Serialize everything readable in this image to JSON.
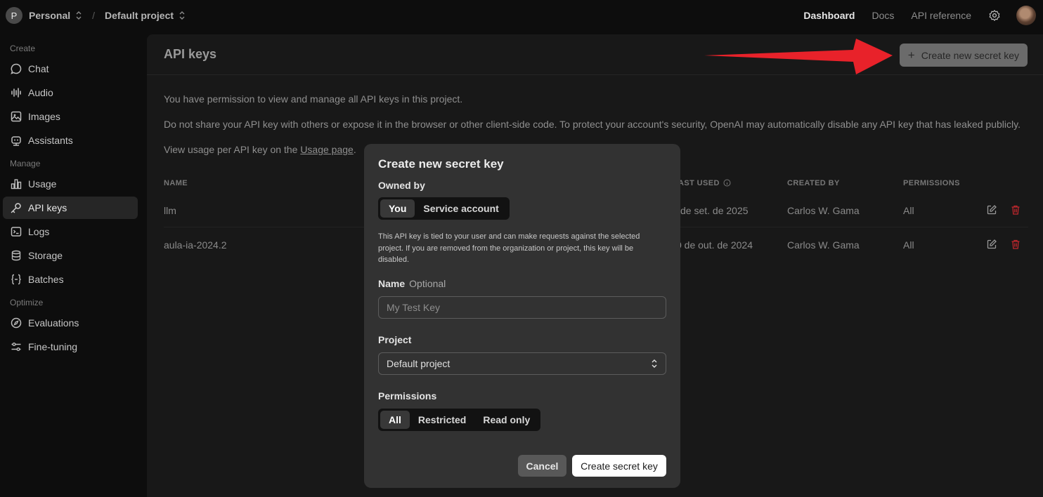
{
  "topbar": {
    "org_initial": "P",
    "org_name": "Personal",
    "separator": "/",
    "project_name": "Default project",
    "nav": [
      "Dashboard",
      "Docs",
      "API reference"
    ]
  },
  "sidebar": {
    "sections": [
      "Create",
      "Manage",
      "Optimize"
    ],
    "items": [
      {
        "label": "Chat",
        "icon": "chat-bubble-icon"
      },
      {
        "label": "Audio",
        "icon": "audio-wave-icon"
      },
      {
        "label": "Images",
        "icon": "image-icon"
      },
      {
        "label": "Assistants",
        "icon": "robot-icon"
      },
      {
        "label": "Usage",
        "icon": "bar-chart-icon"
      },
      {
        "label": "API keys",
        "icon": "key-icon",
        "active": true
      },
      {
        "label": "Logs",
        "icon": "terminal-icon"
      },
      {
        "label": "Storage",
        "icon": "database-icon"
      },
      {
        "label": "Batches",
        "icon": "braces-icon"
      },
      {
        "label": "Evaluations",
        "icon": "compass-icon"
      },
      {
        "label": "Fine-tuning",
        "icon": "sliders-icon"
      }
    ]
  },
  "main": {
    "title": "API keys",
    "create_button": "Create new secret key",
    "desc1": "You have permission to view and manage all API keys in this project.",
    "desc2": "Do not share your API key with others or expose it in the browser or other client-side code. To protect your account's security, OpenAI may automatically disable any API key that has leaked publicly.",
    "desc3_prefix": "View usage per API key on the ",
    "desc3_link": "Usage page",
    "desc3_suffix": ".",
    "columns": [
      "NAME",
      "AST USED",
      "CREATED BY",
      "PERMISSIONS"
    ],
    "rows": [
      {
        "name": "llm",
        "last_used": "de set. de 2025",
        "created_by": "Carlos W. Gama",
        "permissions": "All"
      },
      {
        "name": "aula-ia-2024.2",
        "last_used": "0 de out. de 2024",
        "created_by": "Carlos W. Gama",
        "permissions": "All"
      }
    ]
  },
  "modal": {
    "title": "Create new secret key",
    "owned_by_label": "Owned by",
    "owned_by_options": [
      "You",
      "Service account"
    ],
    "owned_by_selected": "You",
    "note": "This API key is tied to your user and can make requests against the selected project. If you are removed from the organization or project, this key will be disabled.",
    "name_label": "Name",
    "name_optional": "Optional",
    "name_placeholder": "My Test Key",
    "project_label": "Project",
    "project_value": "Default project",
    "permissions_label": "Permissions",
    "permissions_options": [
      "All",
      "Restricted",
      "Read only"
    ],
    "permissions_selected": "All",
    "cancel": "Cancel",
    "submit": "Create secret key"
  },
  "colors": {
    "annotation_arrow": "#e8222a",
    "delete_icon": "#c0272d"
  }
}
